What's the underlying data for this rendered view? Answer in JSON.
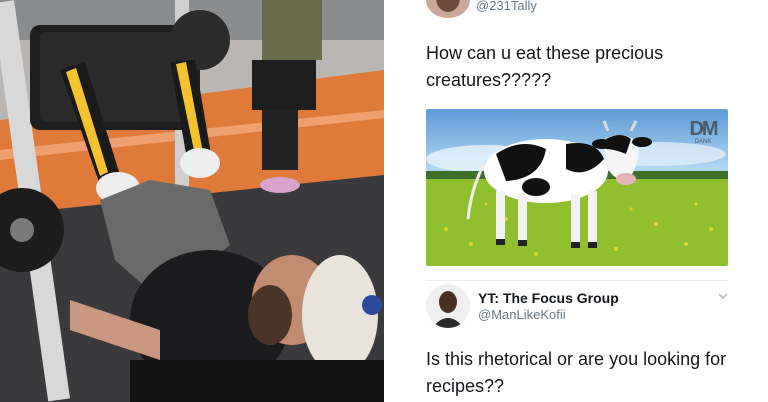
{
  "top_tweet": {
    "handle": "@231Tally",
    "text": "How can u eat these precious creatures?????"
  },
  "cow_image": {
    "watermark_mark": "DM",
    "watermark_text": "DANK"
  },
  "reply": {
    "name": "YT: The Focus Group",
    "handle": "@ManLikeKofii",
    "text": "Is this rhetorical or are you looking for recipes??"
  },
  "colors": {
    "tweet_text": "#14171a",
    "handle": "#657786",
    "sky": "#6fa6dc",
    "grass": "#8fbf2f",
    "gym_floor": "#e07a3a"
  }
}
